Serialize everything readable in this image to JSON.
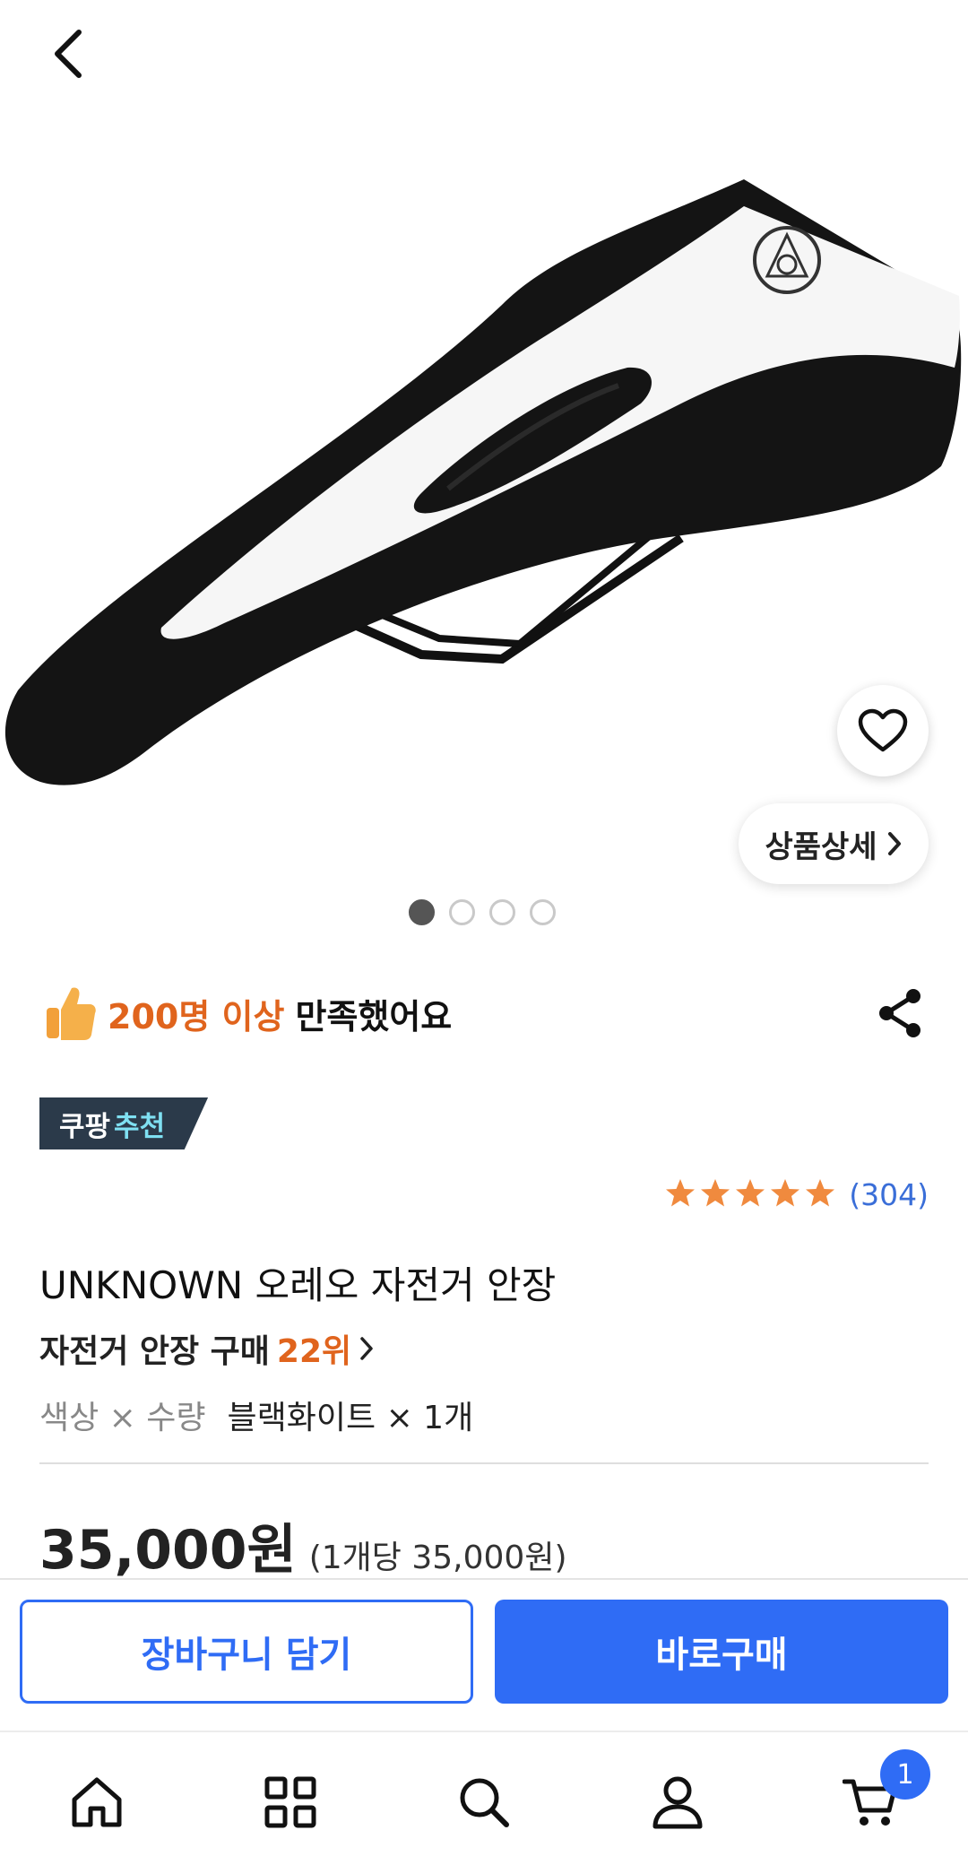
{
  "header": {
    "back_icon": "chevron-left-icon"
  },
  "hero": {
    "image_subject": "bicycle-saddle-image",
    "detail_button_label": "상품상세",
    "carousel": {
      "total": 4,
      "active": 1
    }
  },
  "satisfaction": {
    "highlight": "200명 이상",
    "text": "만족했어요"
  },
  "badge": {
    "part1": "쿠팡",
    "part2": "추천"
  },
  "rating": {
    "stars": 5,
    "count": "(304)"
  },
  "product": {
    "name": "UNKNOWN 오레오 자전거 안장",
    "rank_prefix": "자전거 안장 구매",
    "rank_value": "22위",
    "option_label": "색상 × 수량",
    "option_value": "블랙화이트 × 1개"
  },
  "price": {
    "main": "35,000원",
    "unit_price": "(1개당 35,000원)"
  },
  "actions": {
    "cart_label": "장바구니 담기",
    "buy_label": "바로구매"
  },
  "tabbar": {
    "items": [
      "home-icon",
      "category-grid-icon",
      "search-icon",
      "user-icon",
      "cart-icon"
    ],
    "cart_count": "1"
  },
  "colors": {
    "accent_blue": "#2f6cf5",
    "highlight_orange": "#e0641d",
    "star_orange": "#f08a3e",
    "badge_dark": "#2b3a4a",
    "badge_accent": "#7fe0f2"
  }
}
